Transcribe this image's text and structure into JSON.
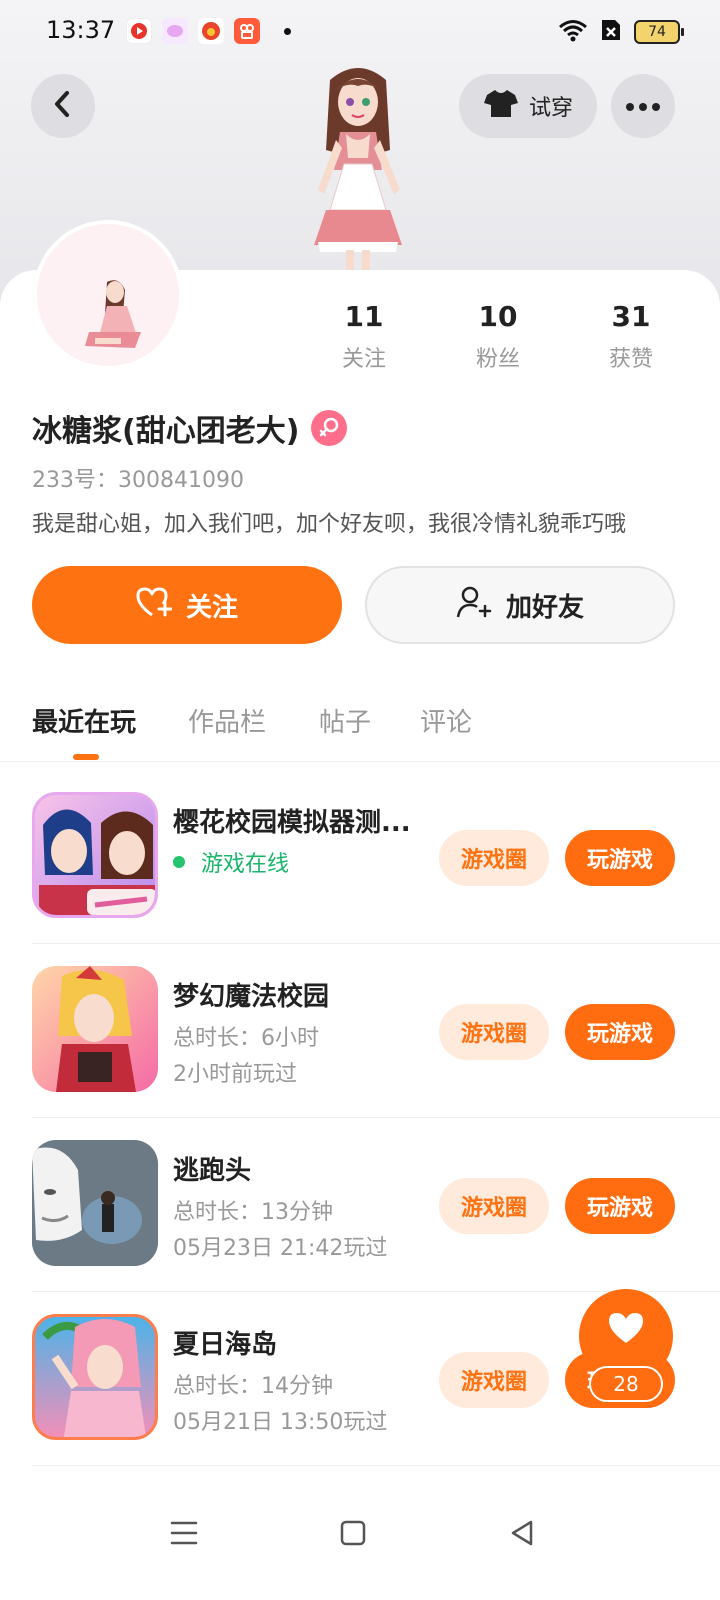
{
  "status_bar": {
    "time": "13:37",
    "battery": "74"
  },
  "header": {
    "try_on_label": "试穿"
  },
  "profile": {
    "name": "冰糖浆(甜心团老大)",
    "uid": "233号：300841090",
    "bio": "我是甜心姐，加入我们吧，加个好友呗，我很冷情礼貌乖巧哦",
    "stats": [
      {
        "value": "11",
        "label": "关注"
      },
      {
        "value": "10",
        "label": "粉丝"
      },
      {
        "value": "31",
        "label": "获赞"
      }
    ],
    "follow_label": "关注",
    "add_friend_label": "加好友"
  },
  "tabs": [
    "最近在玩",
    "作品栏",
    "帖子",
    "评论"
  ],
  "games": [
    {
      "title": "樱花校园模拟器测...",
      "online": "游戏在线",
      "circle": "游戏圈",
      "play": "玩游戏"
    },
    {
      "title": "梦幻魔法校园",
      "duration": "总时长：6小时",
      "last": "2小时前玩过",
      "circle": "游戏圈",
      "play": "玩游戏"
    },
    {
      "title": "逃跑头",
      "duration": "总时长：13分钟",
      "last": "05月23日 21:42玩过",
      "circle": "游戏圈",
      "play": "玩游戏"
    },
    {
      "title": "夏日海岛",
      "duration": "总时长：14分钟",
      "last": "05月21日 13:50玩过",
      "circle": "游戏圈",
      "play": "玩游戏"
    }
  ],
  "like_count": "28",
  "colors": {
    "accent": "#ff7211",
    "online": "#19b56a",
    "circle_bg": "#ffeadc"
  }
}
